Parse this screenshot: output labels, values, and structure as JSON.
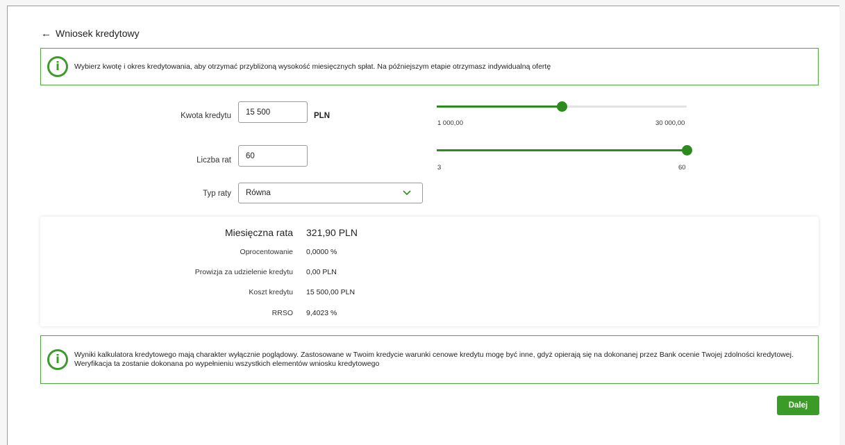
{
  "header": {
    "back_icon": "arrow-left-icon",
    "title": "Wniosek kredytowy"
  },
  "info_top": {
    "icon": "info-icon",
    "text": "Wybierz kwotę i okres kredytowania, aby otrzymać przybliżoną wysokość miesięcznych spłat. Na późniejszym etapie otrzymasz indywidualną ofertę"
  },
  "form": {
    "amount": {
      "label": "Kwota kredytu",
      "value": "15 500",
      "unit": "PLN",
      "slider_min_label": "1 000,00",
      "slider_max_label": "30 000,00",
      "slider_min": 1000,
      "slider_max": 30000,
      "slider_value": 15500
    },
    "installments": {
      "label": "Liczba rat",
      "value": "60",
      "slider_min_label": "3",
      "slider_max_label": "60",
      "slider_min": 3,
      "slider_max": 60,
      "slider_value": 60
    },
    "rate_type": {
      "label": "Typ raty",
      "selected": "Równa",
      "icon": "chevron-down-icon"
    }
  },
  "results": {
    "monthly": {
      "label": "Miesięczna rata",
      "value": "321,90 PLN"
    },
    "interest": {
      "label": "Oprocentowanie",
      "value": "0,0000 %"
    },
    "commission": {
      "label": "Prowizja za udzielenie kredytu",
      "value": "0,00 PLN"
    },
    "cost": {
      "label": "Koszt kredytu",
      "value": "15 500,00 PLN"
    },
    "rrso": {
      "label": "RRSO",
      "value": "9,4023 %"
    }
  },
  "info_bottom": {
    "icon": "info-icon",
    "text": "Wyniki kalkulatora kredytowego mają charakter wyłącznie poglądowy. Zastosowane w Twoim kredycie warunki cenowe kredytu mogę być inne, gdyż opierają się na dokonanej przez Bank ocenie Twojej zdolności kredytowej. Weryfikacja ta zostanie dokonana po wypełnieniu wszystkich elementów wniosku kredytowego"
  },
  "actions": {
    "next_label": "Dalej"
  },
  "colors": {
    "accent": "#2c8a1e",
    "border_info": "#4caa3c",
    "button": "#3b9b27"
  }
}
